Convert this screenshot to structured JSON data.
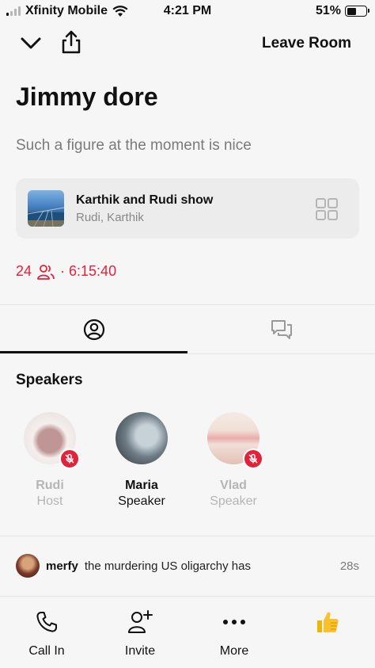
{
  "status_bar": {
    "carrier": "Xfinity Mobile",
    "time": "4:21 PM",
    "battery": "51%",
    "battery_level": 0.51
  },
  "top_bar": {
    "collapse_icon": "chevron-down-icon",
    "share_icon": "share-icon",
    "leave_label": "Leave Room"
  },
  "room": {
    "title": "Jimmy dore",
    "description": "Such a figure at the moment is nice",
    "listener_count": "24",
    "duration": "· 6:15:40",
    "accent_color": "#e0223b"
  },
  "club": {
    "name": "Karthik and Rudi show",
    "members": "Rudi, Karthik"
  },
  "tabs": [
    {
      "icon": "user-icon",
      "active": true
    },
    {
      "icon": "chat-bubbles-icon",
      "active": false
    }
  ],
  "speakers_section": {
    "heading": "Speakers",
    "speakers": [
      {
        "name": "Rudi",
        "role": "Host",
        "muted": true
      },
      {
        "name": "Maria",
        "role": "Speaker",
        "muted": false
      },
      {
        "name": "Vlad",
        "role": "Speaker",
        "muted": true
      }
    ]
  },
  "chat": {
    "user": "merfy",
    "message": "the murdering US oligarchy has",
    "time": "28s"
  },
  "bottom_bar": {
    "items": [
      {
        "label": "Call In",
        "icon": "phone-icon"
      },
      {
        "label": "Invite",
        "icon": "add-user-icon"
      },
      {
        "label": "More",
        "icon": "more-icon"
      }
    ],
    "reaction_icon": "thumbs-up-icon"
  }
}
